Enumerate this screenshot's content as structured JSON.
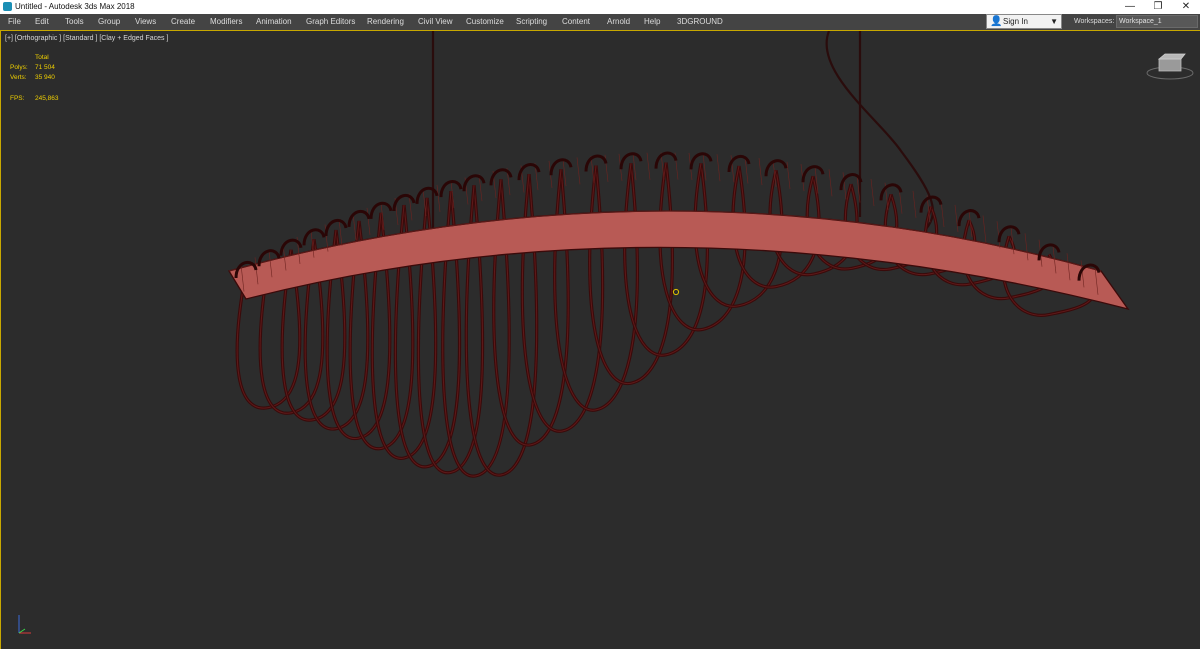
{
  "window": {
    "title": "Untitled - Autodesk 3ds Max 2018",
    "controls": {
      "minimize": "—",
      "restore": "❐",
      "close": "✕"
    }
  },
  "menu": {
    "items": [
      "File",
      "Edit",
      "Tools",
      "Group",
      "Views",
      "Create",
      "Modifiers",
      "Animation",
      "Graph Editors",
      "Rendering",
      "Civil View",
      "Customize",
      "Scripting",
      "Content",
      "Arnold",
      "Help",
      "3DGROUND"
    ],
    "signin": {
      "label": "Sign In",
      "icon": "user-icon"
    },
    "workspaces_label": "Workspaces:",
    "workspace_selected": "Workspace_1"
  },
  "viewport": {
    "label": "[+] [Orthographic ] [Standard ] [Clay + Edged Faces ]",
    "stats": {
      "header": "Total",
      "polys_label": "Polys:",
      "polys_value": "71 504",
      "verts_label": "Verts:",
      "verts_value": "35 940",
      "fps_label": "FPS:",
      "fps_value": "245,863"
    }
  },
  "colors": {
    "background": "#2c2c2c",
    "menu_bar": "#444444",
    "model_fill": "#b85a55",
    "model_wire": "#3a0a0a",
    "viewport_border": "#c8a800",
    "stats_text": "#f0d000"
  }
}
